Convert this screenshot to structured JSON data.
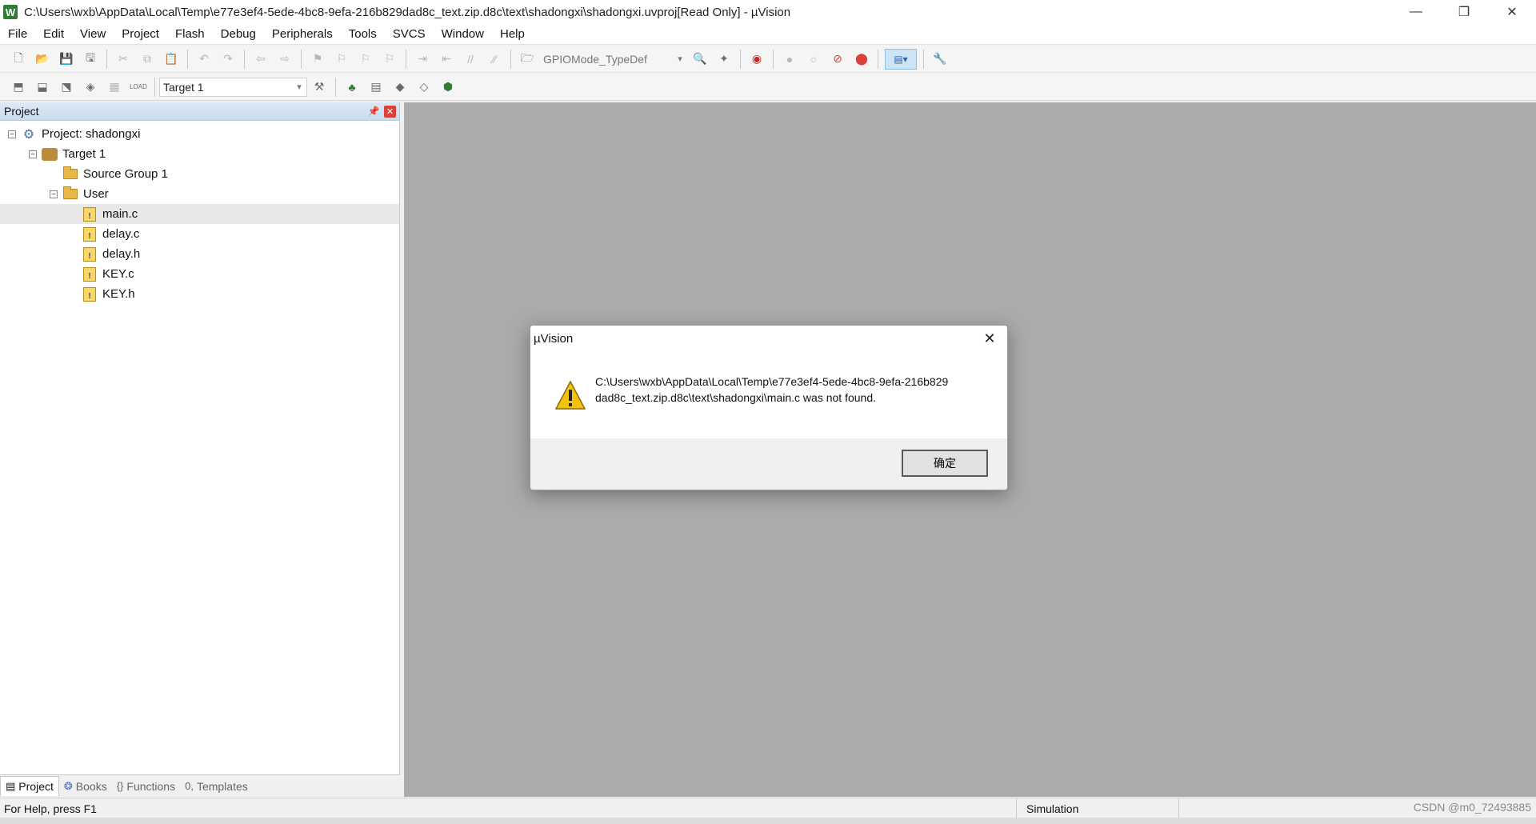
{
  "window": {
    "title": "C:\\Users\\wxb\\AppData\\Local\\Temp\\e77e3ef4-5ede-4bc8-9efa-216b829dad8c_text.zip.d8c\\text\\shadongxi\\shadongxi.uvproj[Read Only]  - µVision",
    "app_icon": "W"
  },
  "menu": [
    "File",
    "Edit",
    "View",
    "Project",
    "Flash",
    "Debug",
    "Peripherals",
    "Tools",
    "SVCS",
    "Window",
    "Help"
  ],
  "toolbar1": {
    "find_combo": "GPIOMode_TypeDef"
  },
  "toolbar2": {
    "target_combo": "Target 1",
    "load_label": "LOAD"
  },
  "project_panel": {
    "title": "Project",
    "tree": {
      "project": "Project: shadongxi",
      "target": "Target 1",
      "groups": [
        {
          "name": "Source Group 1",
          "files": []
        },
        {
          "name": "User",
          "files": [
            "main.c",
            "delay.c",
            "delay.h",
            "KEY.c",
            "KEY.h"
          ]
        }
      ]
    },
    "tabs": [
      "Project",
      "Books",
      "Functions",
      "Templates"
    ]
  },
  "status": {
    "help": "For Help, press F1",
    "mode": "Simulation",
    "watermark": "CSDN @m0_72493885"
  },
  "dialog": {
    "title": "µVision",
    "message_line1": "C:\\Users\\wxb\\AppData\\Local\\Temp\\e77e3ef4-5ede-4bc8-9efa-216b829",
    "message_line2": "dad8c_text.zip.d8c\\text\\shadongxi\\main.c was not found.",
    "ok_label": "确定"
  }
}
